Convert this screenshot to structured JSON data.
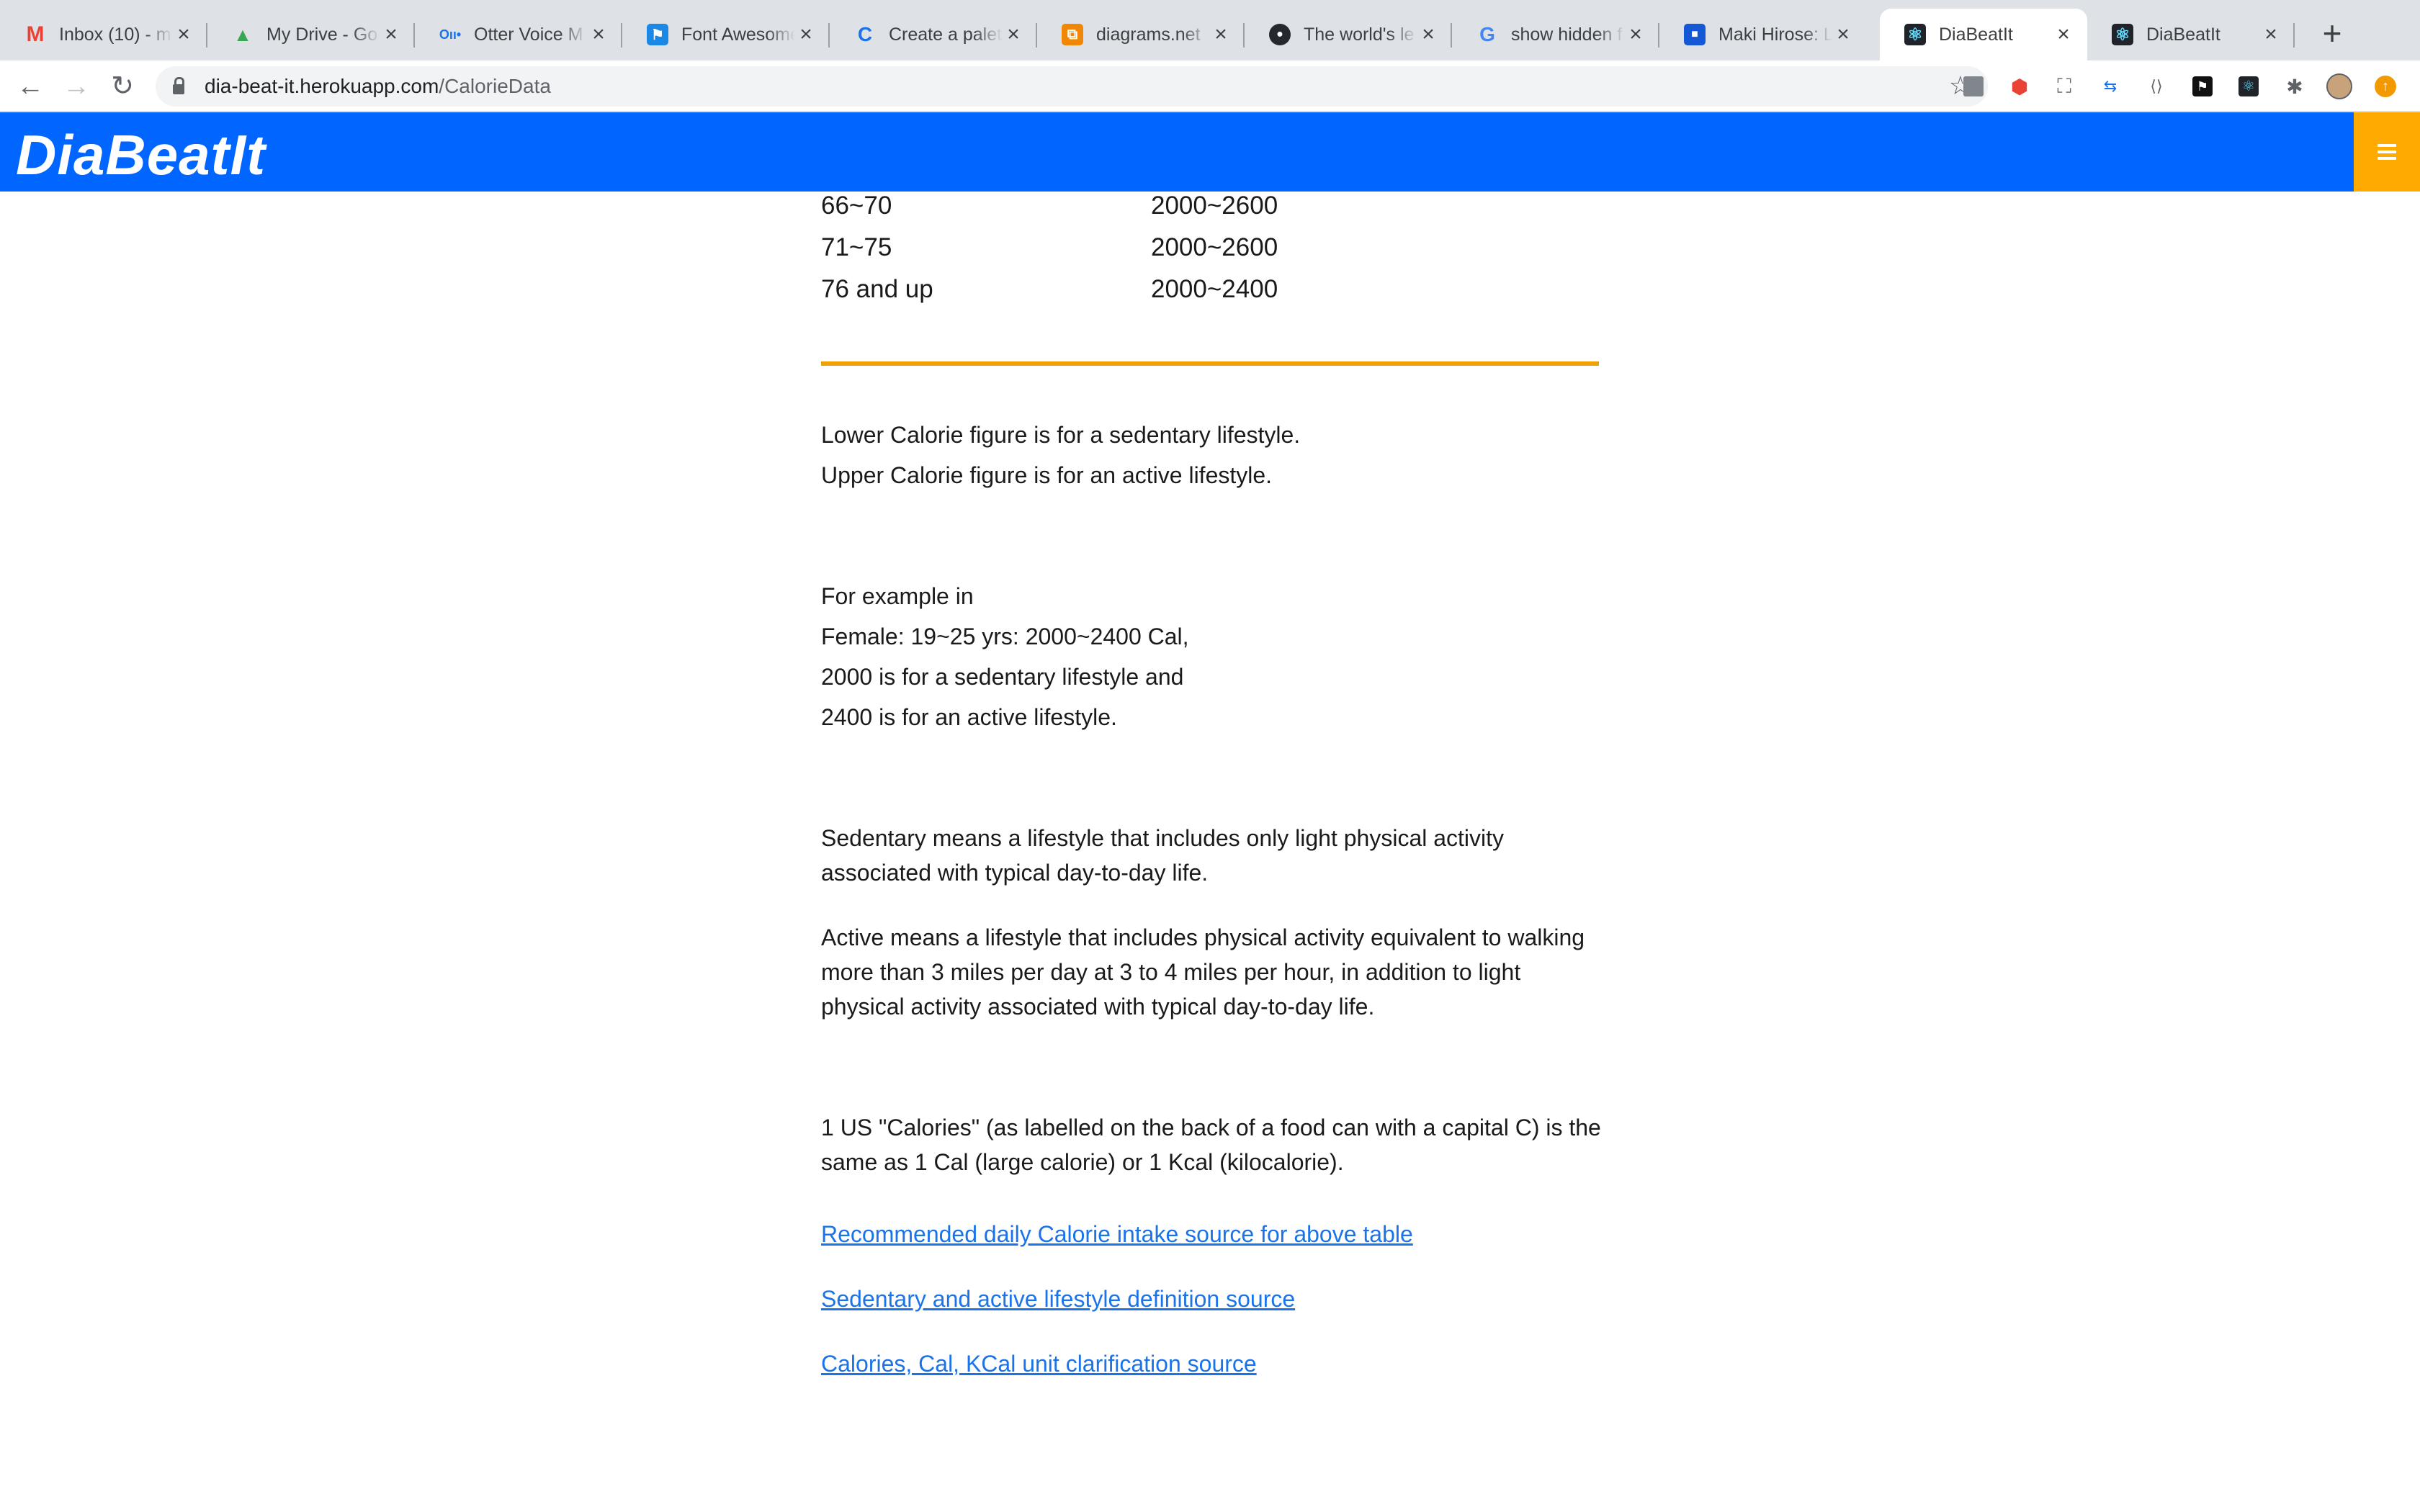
{
  "browser": {
    "tabs": [
      {
        "title": "Inbox (10) - m",
        "icon": "gmail-icon",
        "color": "#ea4335",
        "glyph": "M"
      },
      {
        "title": "My Drive - Go",
        "icon": "google-drive-icon",
        "color": "#34a853",
        "glyph": "▲"
      },
      {
        "title": "Otter Voice M",
        "icon": "otter-icon",
        "color": "#1a73e8",
        "glyph": "oo"
      },
      {
        "title": "Font Awesome",
        "icon": "font-awesome-flag-icon",
        "color": "#1c88e5",
        "glyph": "⚑"
      },
      {
        "title": "Create a palet",
        "icon": "coolors-icon",
        "color": "#1a73e8",
        "glyph": "C"
      },
      {
        "title": "diagrams.net",
        "icon": "diagrams-net-icon",
        "color": "#f08705",
        "glyph": "⧉"
      },
      {
        "title": "The world's le",
        "icon": "github-icon",
        "color": "#24292e",
        "glyph": "●"
      },
      {
        "title": "show hidden f",
        "icon": "google-icon",
        "color": "#4285f4",
        "glyph": "G"
      },
      {
        "title": "Maki Hirose: L",
        "icon": "trello-icon",
        "color": "#1558d6",
        "glyph": "■"
      },
      {
        "title": "DiaBeatIt",
        "icon": "react-icon",
        "color": "#20232a",
        "glyph": "⚛"
      },
      {
        "title": "DiaBeatIt",
        "icon": "react-icon",
        "color": "#20232a",
        "glyph": "⚛"
      }
    ],
    "active_tab_index": 9,
    "url_host": "dia-beat-it.herokuapp.com",
    "url_path": "/CalorieData"
  },
  "app": {
    "brand": "DiaBeatIt"
  },
  "calorie_table": {
    "rows": [
      {
        "age": "66~70",
        "calories": "2000~2600"
      },
      {
        "age": "71~75",
        "calories": "2000~2600"
      },
      {
        "age": "76 and up",
        "calories": "2000~2400"
      }
    ]
  },
  "notes": {
    "lower_line": "Lower Calorie figure is for a sedentary lifestyle.",
    "upper_line": "Upper Calorie figure is for an active lifestyle.",
    "example": [
      "For example in",
      "Female: 19~25 yrs: 2000~2400 Cal,",
      "2000 is for a sedentary lifestyle and",
      "2400 is for an active lifestyle."
    ],
    "sedentary_definition": "Sedentary means a lifestyle that includes only light physical activity associated with typical day-to-day life.",
    "active_definition": "Active means a lifestyle that includes physical activity equivalent to walking more than 3 miles per day at 3 to 4 miles per hour, in addition to light physical activity associated with typical day-to-day life.",
    "calorie_unit_note": "1 US \"Calories\" (as labelled on the back of a food can with a capital C) is the same as 1 Cal (large calorie) or 1 Kcal (kilocalorie)."
  },
  "links": [
    "Recommended daily Calorie intake source for above table",
    "Sedentary and active lifestyle definition source",
    "Calories, Cal, KCal unit clarification source"
  ]
}
